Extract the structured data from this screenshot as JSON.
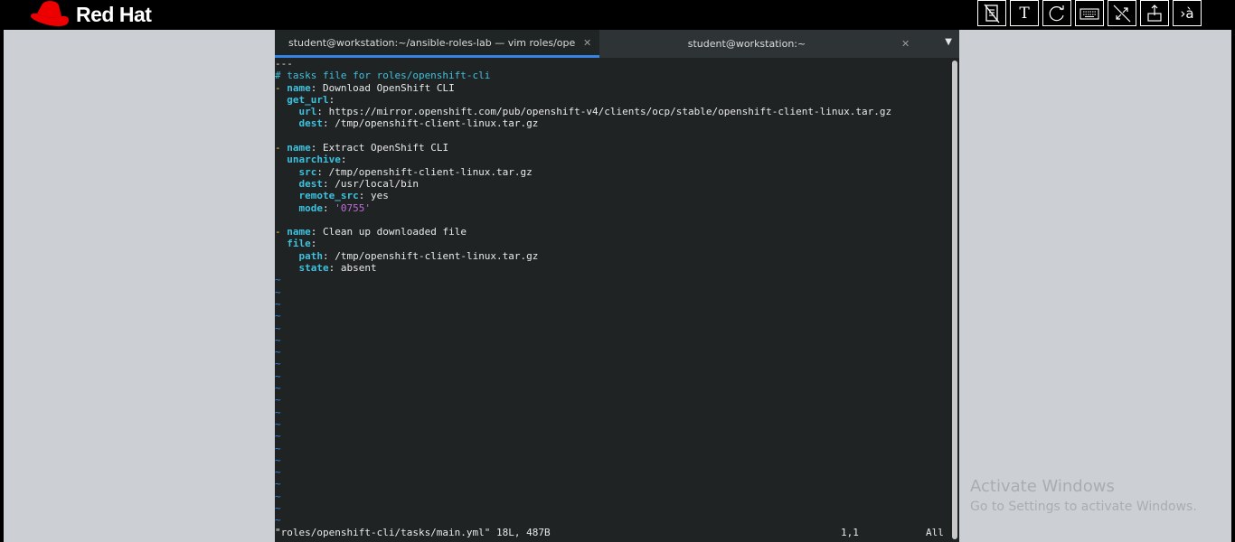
{
  "brand": {
    "name": "Red Hat"
  },
  "toolbar": {
    "items": [
      {
        "icon": "notes-icon",
        "label": ""
      },
      {
        "icon": "text-icon",
        "label": "T"
      },
      {
        "icon": "refresh-icon",
        "label": ""
      },
      {
        "icon": "keyboard-icon",
        "label": ""
      },
      {
        "icon": "fullscreen-off-icon",
        "label": ""
      },
      {
        "icon": "upload-icon",
        "label": ""
      },
      {
        "icon": "language-icon",
        "label": "›à"
      }
    ]
  },
  "terminal": {
    "tabs": [
      {
        "label": "student@workstation:~/ansible-roles-lab — vim roles/openshi…",
        "active": true
      },
      {
        "label": "student@workstation:~",
        "active": false
      }
    ],
    "lines": [
      "---",
      "# tasks file for roles/openshift-cli",
      "- name: Download OpenShift CLI",
      "  get_url:",
      "    url: https://mirror.openshift.com/pub/openshift-v4/clients/ocp/stable/openshift-client-linux.tar.gz",
      "    dest: /tmp/openshift-client-linux.tar.gz",
      "",
      "- name: Extract OpenShift CLI",
      "  unarchive:",
      "    src: /tmp/openshift-client-linux.tar.gz",
      "    dest: /usr/local/bin",
      "    remote_src: yes",
      "    mode: '0755'",
      "",
      "- name: Clean up downloaded file",
      "  file:",
      "    path: /tmp/openshift-client-linux.tar.gz",
      "    state: absent"
    ],
    "tilde_count": 21,
    "status": {
      "file": "\"roles/openshift-cli/tasks/main.yml\" 18L, 487B",
      "position": "1,1",
      "scroll": "All"
    }
  },
  "watermark": {
    "title": "Activate Windows",
    "subtitle": "Go to Settings to activate Windows."
  },
  "colors": {
    "brand_red": "#ee0000",
    "yaml_key": "#3ec1de",
    "yaml_string": "#c06bd8",
    "yaml_dash": "#f4d54a",
    "vim_tilde": "#3584e4",
    "tab_underline": "#3584e4"
  }
}
